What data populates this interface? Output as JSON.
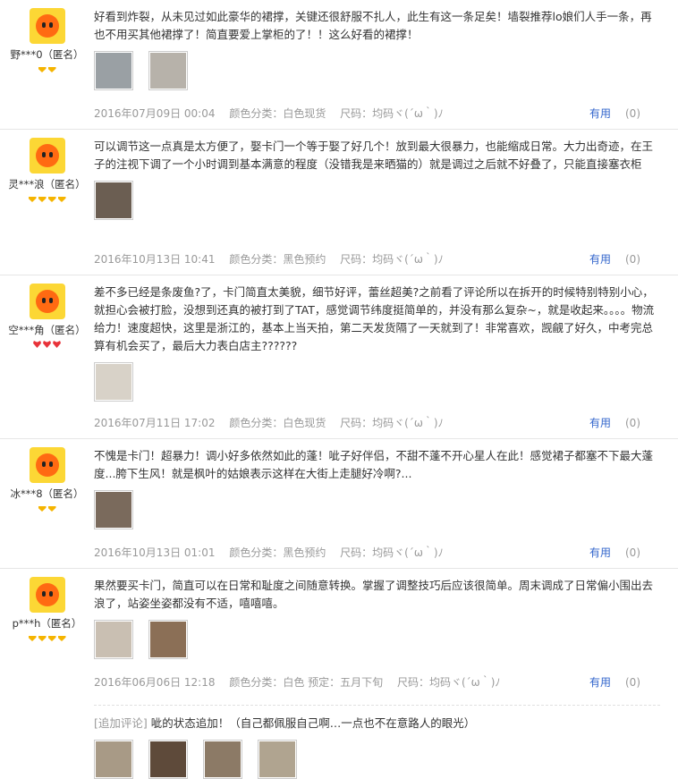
{
  "reviews": [
    {
      "user": "野***0（匿名）",
      "rank_type": "gem",
      "rank_count": 2,
      "text": "好看到炸裂，从未见过如此豪华的裙撑，关键还很舒服不扎人，此生有这一条足矣！墙裂推荐lo娘们人手一条，再也不用买其他裙撑了！简直要爱上掌柜的了！！这么好看的裙撑！",
      "photos": [
        "#9aa0a4",
        "#b7b2aa"
      ],
      "date": "2016年07月09日 00:04",
      "spec": "颜色分类：白色现货",
      "size": "尺码：均码ヾ(´ω｀)ﾉ",
      "helpful_label": "有用",
      "helpful_count": "(0)"
    },
    {
      "user": "灵***浪（匿名）",
      "rank_type": "gem",
      "rank_count": 4,
      "text": "可以调节这一点真是太方便了，娶卡门一个等于娶了好几个！放到最大很暴力，也能缩成日常。大力出奇迹，在王子的注视下调了一个小时调到基本满意的程度（没错我是来晒猫的）就是调过之后就不好叠了，只能直接塞衣柜",
      "photos": [
        "#6b5e52"
      ],
      "date": "2016年10月13日 10:41",
      "spec": "颜色分类：黑色预约",
      "size": "尺码：均码ヾ(´ω｀)ﾉ",
      "helpful_label": "有用",
      "helpful_count": "(0)"
    },
    {
      "user": "空***角（匿名）",
      "rank_type": "heart",
      "rank_count": 3,
      "text": "差不多已经是条废鱼?了，卡门简直太美貌，细节好评，蕾丝超美?之前看了评论所以在拆开的时候特别特别小心，就担心会被打脸，没想到还真的被打到了TAT，感觉调节纬度挺简单的，并没有那么复杂~，就是收起来。。。。物流给力！速度超快，这里是浙江的，基本上当天拍，第二天发货隔了一天就到了！非常喜欢，觊觎了好久，中考完总算有机会买了，最后大力表白店主??????",
      "photos": [
        "#d8d2c8"
      ],
      "date": "2016年07月11日 17:02",
      "spec": "颜色分类：白色现货",
      "size": "尺码：均码ヾ(´ω｀)ﾉ",
      "helpful_label": "有用",
      "helpful_count": "(0)"
    },
    {
      "user": "冰***8（匿名）",
      "rank_type": "gem",
      "rank_count": 2,
      "text": "不愧是卡门！超暴力！调小好多依然如此的蓬！呲子好伴侣，不甜不蓬不开心星人在此！感觉裙子都塞不下最大蓬度...胯下生风！就是枫叶的姑娘表示这样在大街上走腿好冷啊?...",
      "photos": [
        "#7a6a5c"
      ],
      "date": "2016年10月13日 01:01",
      "spec": "颜色分类：黑色预约",
      "size": "尺码：均码ヾ(´ω｀)ﾉ",
      "helpful_label": "有用",
      "helpful_count": "(0)"
    },
    {
      "user": "p***h（匿名）",
      "rank_type": "gem",
      "rank_count": 4,
      "text": "果然要买卡门，简直可以在日常和耻度之间随意转换。掌握了调整技巧后应该很简单。周末调成了日常偏小围出去浪了，站姿坐姿都没有不适，嘻嘻嘻。",
      "photos": [
        "#c9bfb2",
        "#8b6f56"
      ],
      "date": "2016年06月06日 12:18",
      "spec": "颜色分类：白色  预定：五月下旬",
      "size": "尺码：均码ヾ(´ω｀)ﾉ",
      "helpful_label": "有用",
      "helpful_count": "(0)",
      "followup_tag": "[追加评论]",
      "followup_text": "呲的状态追加！（自己都佩服自己啊…一点也不在意路人的眼光）",
      "followup_photos": [
        "#a89a86",
        "#5e4a3a",
        "#8c7a66",
        "#b0a490"
      ]
    }
  ],
  "colors": {
    "link": "#3366cc",
    "meta": "#999999",
    "avatar_bg": "#fcd735",
    "avatar_head": "#ff6a12",
    "gem": "#f5b400",
    "heart": "#e8333a"
  }
}
